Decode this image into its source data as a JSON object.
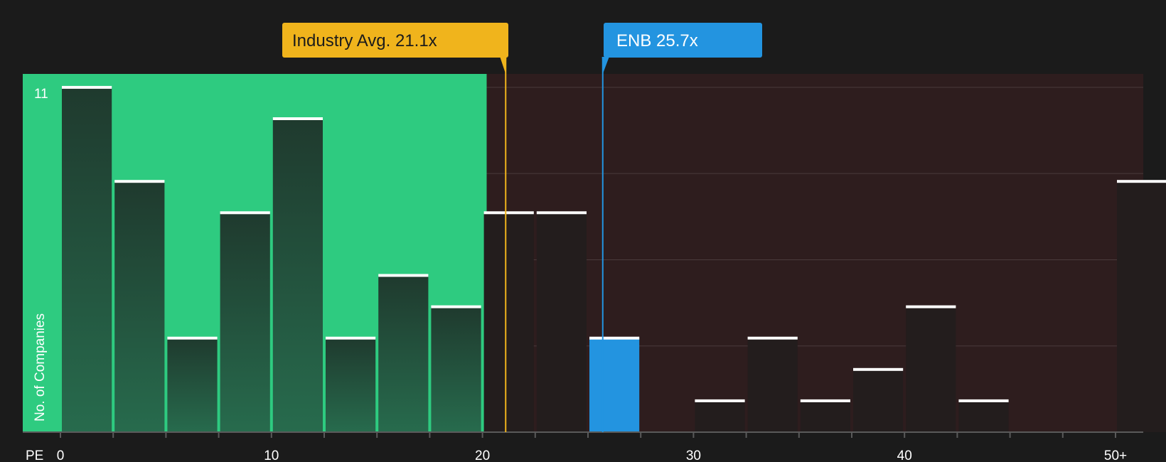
{
  "chart_data": {
    "type": "bar",
    "xlabel": "PE",
    "ylabel": "No. of Companies",
    "x_ticks": [
      "0",
      "10",
      "20",
      "30",
      "40",
      "50+"
    ],
    "y_ticks": [
      "11"
    ],
    "xlim": [
      0,
      51.2
    ],
    "ylim": [
      0,
      11.35
    ],
    "bin_width": 2.5,
    "bins": [
      {
        "start": 0,
        "count": 11
      },
      {
        "start": 2.5,
        "count": 8
      },
      {
        "start": 5,
        "count": 3
      },
      {
        "start": 7.5,
        "count": 7
      },
      {
        "start": 10,
        "count": 10
      },
      {
        "start": 12.5,
        "count": 3
      },
      {
        "start": 15,
        "count": 5
      },
      {
        "start": 17.5,
        "count": 4
      },
      {
        "start": 20,
        "count": 7
      },
      {
        "start": 22.5,
        "count": 7
      },
      {
        "start": 25,
        "count": 3
      },
      {
        "start": 27.5,
        "count": 0
      },
      {
        "start": 30,
        "count": 1
      },
      {
        "start": 32.5,
        "count": 3
      },
      {
        "start": 35,
        "count": 1
      },
      {
        "start": 37.5,
        "count": 2
      },
      {
        "start": 40,
        "count": 4
      },
      {
        "start": 42.5,
        "count": 1
      },
      {
        "start": 45,
        "count": 0
      },
      {
        "start": 47.5,
        "count": 0
      },
      {
        "start": 50,
        "count": 8
      }
    ],
    "good_value_max": 20.2,
    "highlight_bin_start": 25,
    "markers": [
      {
        "label": "Industry Avg. 21.1x",
        "value": 21.1,
        "color": "#f0b41c",
        "text_color": "#1b1b1b"
      },
      {
        "label": "ENB 25.7x",
        "value": 25.7,
        "color": "#2394e0",
        "text_color": "#ffffff"
      }
    ],
    "colors": {
      "background": "#1b1b1b",
      "good_zone": "#2ecb80",
      "good_bar_top": "#1f3a2e",
      "good_bar_bottom": "#276b4d",
      "bad_zone": "#2e1d1e",
      "bad_bar": "#231d1d",
      "highlight_bar": "#2394e0",
      "bar_cap": "#ffffff",
      "gridline": "#4a3b3c",
      "axis": "#5a5a5a"
    }
  }
}
